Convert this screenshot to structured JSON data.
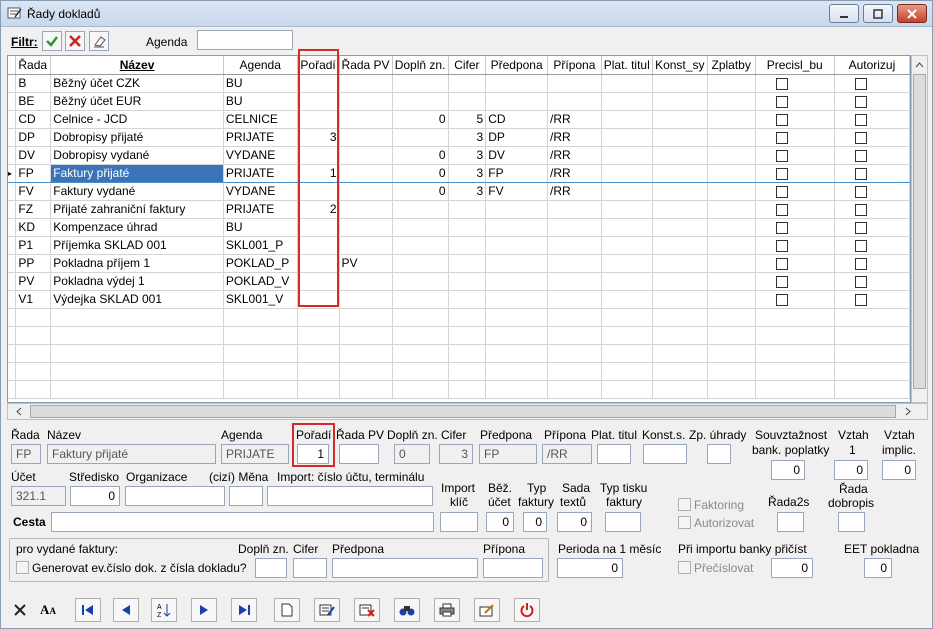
{
  "window": {
    "title": "Řady dokladů"
  },
  "filter": {
    "label": "Filtr:",
    "agenda_label": "Agenda",
    "agenda_value": ""
  },
  "grid": {
    "columns": [
      "Řada",
      "Název",
      "Agenda",
      "Pořadí",
      "Řada PV",
      "Doplň zn.",
      "Cifer",
      "Předpona",
      "Přípona",
      "Plat. titul",
      "Konst_sy",
      "Zplatby",
      "Precisl_bu",
      "Autorizuj"
    ],
    "rows": [
      [
        "B",
        "Běžný účet CZK",
        "BU",
        "",
        "",
        "",
        "",
        "",
        "",
        "",
        "",
        "",
        "",
        ""
      ],
      [
        "BE",
        "Běžný účet EUR",
        "BU",
        "",
        "",
        "",
        "",
        "",
        "",
        "",
        "",
        "",
        "",
        ""
      ],
      [
        "CD",
        "Celnice - JCD",
        "CELNICE",
        "",
        "",
        "0",
        "5",
        "CD",
        "/RR",
        "",
        "",
        "",
        "",
        ""
      ],
      [
        "DP",
        "Dobropisy přijaté",
        "PRIJATE",
        "3",
        "",
        "",
        "3",
        "DP",
        "/RR",
        "",
        "",
        "",
        "",
        ""
      ],
      [
        "DV",
        "Dobropisy vydané",
        "VYDANE",
        "",
        "",
        "0",
        "3",
        "DV",
        "/RR",
        "",
        "",
        "",
        "",
        ""
      ],
      [
        "FP",
        "Faktury přijaté",
        "PRIJATE",
        "1",
        "",
        "0",
        "3",
        "FP",
        "/RR",
        "",
        "",
        "",
        "",
        ""
      ],
      [
        "FV",
        "Faktury vydané",
        "VYDANE",
        "",
        "",
        "0",
        "3",
        "FV",
        "/RR",
        "",
        "",
        "",
        "",
        ""
      ],
      [
        "FZ",
        "Přijaté zahraniční faktury",
        "PRIJATE",
        "2",
        "",
        "",
        "",
        "",
        "",
        "",
        "",
        "",
        "",
        ""
      ],
      [
        "KD",
        "Kompenzace úhrad",
        "BU",
        "",
        "",
        "",
        "",
        "",
        "",
        "",
        "",
        "",
        "",
        ""
      ],
      [
        "P1",
        "Příjemka SKLAD 001",
        "SKL001_P",
        "",
        "",
        "",
        "",
        "",
        "",
        "",
        "",
        "",
        "",
        ""
      ],
      [
        "PP",
        "Pokladna příjem 1",
        "POKLAD_P",
        "",
        "PV",
        "",
        "",
        "",
        "",
        "",
        "",
        "",
        "",
        ""
      ],
      [
        "PV",
        "Pokladna výdej  1",
        "POKLAD_V",
        "",
        "",
        "",
        "",
        "",
        "",
        "",
        "",
        "",
        "",
        ""
      ],
      [
        "V1",
        "Výdejka  SKLAD 001",
        "SKL001_V",
        "",
        "",
        "",
        "",
        "",
        "",
        "",
        "",
        "",
        "",
        ""
      ]
    ]
  },
  "detail": {
    "rada_label": "Řada",
    "rada_value": "FP",
    "nazev_label": "Název",
    "nazev_value": "Faktury přijaté",
    "agenda_label": "Agenda",
    "agenda_value": "PRIJATE",
    "poradi_label": "Pořadí",
    "poradi_value": "1",
    "radapv_label": "Řada PV",
    "radapv_value": "",
    "doplnzn_label": "Doplň zn.",
    "doplnzn_value": "0",
    "cifer_label": "Cifer",
    "cifer_value": "3",
    "predpona_label": "Předpona",
    "predpona_value": "FP",
    "pripona_label": "Přípona",
    "pripona_value": "/RR",
    "plattitul_label": "Plat. titul",
    "plattitul_value": "",
    "konsts_label": "Konst.s.",
    "konsts_value": "",
    "zpuhrady_label": "Zp. úhrady",
    "zpuhrady_value": "",
    "souvz_label1": "Souvztažnost",
    "souvz_label2": "bank. poplatky",
    "souvz_value": "0",
    "vztah_label1": "Vztah",
    "vztah_label2": "1",
    "vztah_value": "0",
    "vztahimp_label1": "Vztah",
    "vztahimp_label2": "implic.",
    "vztahimp_value": "0",
    "ucet_label": "Účet",
    "ucet_value": "321.1",
    "stredisko_label": "Středisko",
    "stredisko_value": "0",
    "organizace_label": "Organizace",
    "organizace_value": "",
    "mena_label": "(cizí) Měna",
    "mena_value": "",
    "import_label": "Import: číslo účtu, terminálu",
    "import_value": "",
    "importklic_label1": "Import",
    "importklic_label2": "klíč",
    "importklic_value": "",
    "bezucet_label1": "Běž.",
    "bezucet_label2": "účet",
    "bezucet_value": "0",
    "typfakt_label1": "Typ",
    "typfakt_label2": "faktury",
    "typfakt_value": "0",
    "sadatextu_label1": "Sada",
    "sadatextu_label2": "textů",
    "sadatextu_value": "0",
    "typtisku_label1": "Typ tisku",
    "typtisku_label2": "faktury",
    "typtisku_value": "",
    "faktoring_label": "Faktoring",
    "autorizovat_label": "Autorizovat",
    "rada2s_label": "Řada2s",
    "rada2s_value": "",
    "radadob_label1": "Řada",
    "radadob_label2": "dobropis",
    "radadob_value": "",
    "cesta_label": "Cesta",
    "cesta_value": "",
    "vydane_label": "pro vydané faktury:",
    "generovat_label": "Generovat ev.číslo dok. z čísla dokladu?",
    "v_doplnzn_label": "Doplň zn.",
    "v_doplnzn_value": "",
    "v_cifer_label": "Cifer",
    "v_cifer_value": "",
    "v_predpona_label": "Předpona",
    "v_predpona_value": "",
    "v_pripona_label": "Přípona",
    "v_pripona_value": "",
    "perioda_label": "Perioda na 1 měsíc",
    "perioda_value": "0",
    "pri_import_label": "Při importu banky přičíst",
    "precislovat_label": "Přečíslovat",
    "precislovat_value": "0",
    "eet_label": "EET pokladna",
    "eet_value": "0"
  },
  "colors": {
    "selection": "#3b73b9",
    "highlight_box": "#d62a2a"
  }
}
